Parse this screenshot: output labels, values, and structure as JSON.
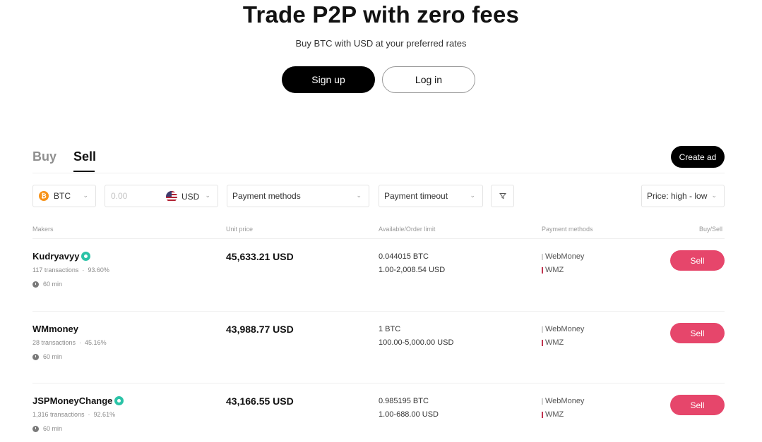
{
  "hero": {
    "title": "Trade P2P with zero fees",
    "subtitle": "Buy BTC with USD at your preferred rates",
    "signup_label": "Sign up",
    "login_label": "Log in"
  },
  "tabs": {
    "buy": "Buy",
    "sell": "Sell",
    "active": "Sell"
  },
  "create_ad_label": "Create ad",
  "filters": {
    "crypto": "BTC",
    "amount_placeholder": "0.00",
    "fiat": "USD",
    "payment_methods": "Payment methods",
    "payment_timeout": "Payment timeout",
    "sort": "Price: high - low"
  },
  "columns": {
    "makers": "Makers",
    "unit_price": "Unit price",
    "available": "Available/Order limit",
    "payment_methods": "Payment methods",
    "action": "Buy/Sell"
  },
  "colors": {
    "accent": "#e6466b",
    "primary": "#000000",
    "verified": "#2bc3a7",
    "btc": "#f7931a",
    "wmz_bar": "#c0344f"
  },
  "rows": [
    {
      "maker": "Kudryavyy",
      "verified": true,
      "transactions": "117 transactions",
      "completion": "93.60%",
      "time": "60 min",
      "price": "45,633.21 USD",
      "available": "0.044015 BTC",
      "limit": "1.00-2,008.54 USD",
      "payment_1": "WebMoney",
      "payment_2": "WMZ",
      "action": "Sell"
    },
    {
      "maker": "WMmoney",
      "verified": false,
      "transactions": "28 transactions",
      "completion": "45.16%",
      "time": "60 min",
      "price": "43,988.77 USD",
      "available": "1 BTC",
      "limit": "100.00-5,000.00 USD",
      "payment_1": "WebMoney",
      "payment_2": "WMZ",
      "action": "Sell"
    },
    {
      "maker": "JSPMoneyChange",
      "verified": true,
      "transactions": "1,316 transactions",
      "completion": "92.61%",
      "time": "60 min",
      "price": "43,166.55 USD",
      "available": "0.985195 BTC",
      "limit": "1.00-688.00 USD",
      "payment_1": "WebMoney",
      "payment_2": "WMZ",
      "action": "Sell"
    }
  ]
}
